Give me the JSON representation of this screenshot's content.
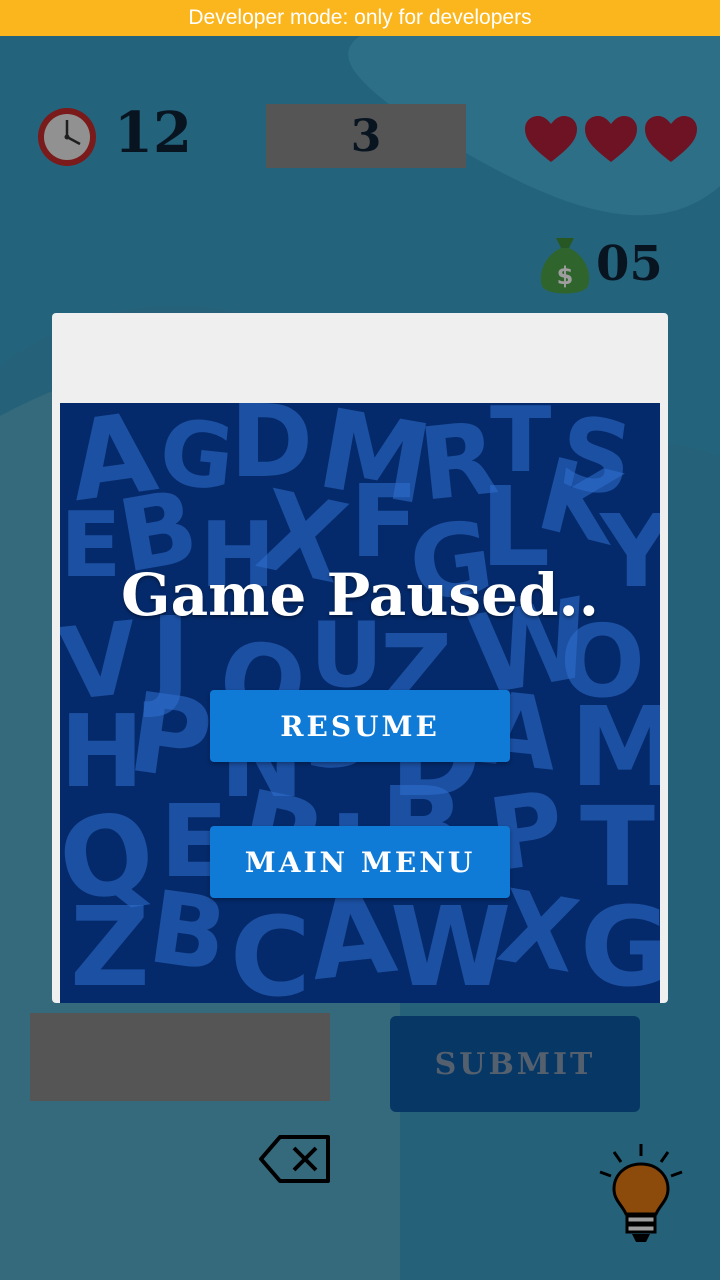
{
  "dev_banner": {
    "text": "Developer mode: only for developers"
  },
  "hud": {
    "timer_icon": "clock-icon",
    "timer_value": "12",
    "level_value": "3",
    "lives": 3,
    "heart_icon": "heart-icon",
    "coin_icon": "money-bag-icon",
    "coins_value": "05"
  },
  "controls": {
    "answer_placeholder": "",
    "submit_label": "SUBMIT",
    "backspace_icon": "backspace-icon",
    "hint_icon": "lightbulb-icon"
  },
  "pause_dialog": {
    "title": "Game Paused..",
    "resume_label": "RESUME",
    "main_menu_label": "MAIN MENU"
  },
  "colors": {
    "banner": "#fbb61d",
    "background": "#3aa0c8",
    "dialog_bg": "#052a6b",
    "button": "#0f7bd6",
    "submit": "#0b5aa4",
    "heart": "#b2203a"
  }
}
